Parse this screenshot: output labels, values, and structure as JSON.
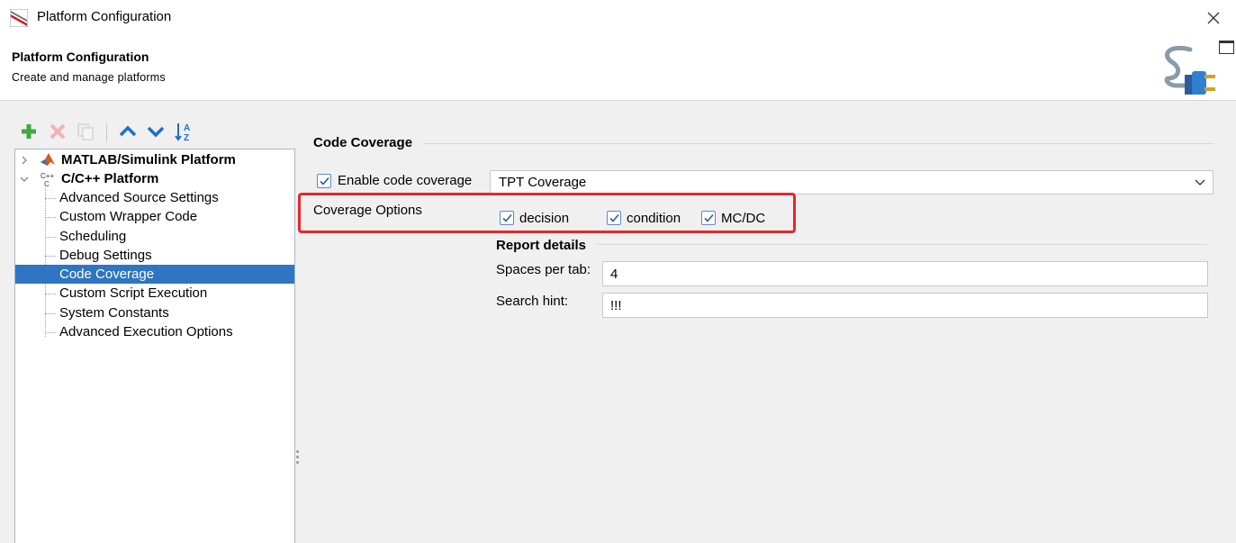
{
  "window": {
    "title": "Platform Configuration",
    "header_title": "Platform Configuration",
    "header_subtitle": "Create and manage platforms"
  },
  "toolbar": {
    "buttons": [
      "add-icon",
      "delete-icon",
      "copy-icon",
      "move-up-icon",
      "move-down-icon",
      "sort-az-icon"
    ]
  },
  "tree": {
    "roots": [
      {
        "label": "MATLAB/Simulink Platform",
        "icon": "matlab-icon",
        "expanded": false
      },
      {
        "label": "C/C++ Platform",
        "icon": "cpp-icon",
        "expanded": true
      }
    ],
    "children": [
      "Advanced Source Settings",
      "Custom Wrapper Code",
      "Scheduling",
      "Debug Settings",
      "Code Coverage",
      "Custom Script Execution",
      "System Constants",
      "Advanced Execution Options"
    ],
    "selected": "Code Coverage"
  },
  "coverage": {
    "section_title": "Code Coverage",
    "enable_label": "Enable code coverage",
    "enable_checked": true,
    "tool_selected": "TPT Coverage",
    "options_label": "Coverage Options",
    "options": [
      {
        "label": "decision",
        "checked": true
      },
      {
        "label": "condition",
        "checked": true
      },
      {
        "label": "MC/DC",
        "checked": true
      }
    ]
  },
  "report": {
    "title": "Report details",
    "spaces_label": "Spaces per tab:",
    "spaces_value": "4",
    "hint_label": "Search hint:",
    "hint_value": "!!!"
  },
  "colors": {
    "selection": "#2f75c1",
    "highlight_box": "#e8262a",
    "checkbox_border": "#5a8ad0"
  }
}
